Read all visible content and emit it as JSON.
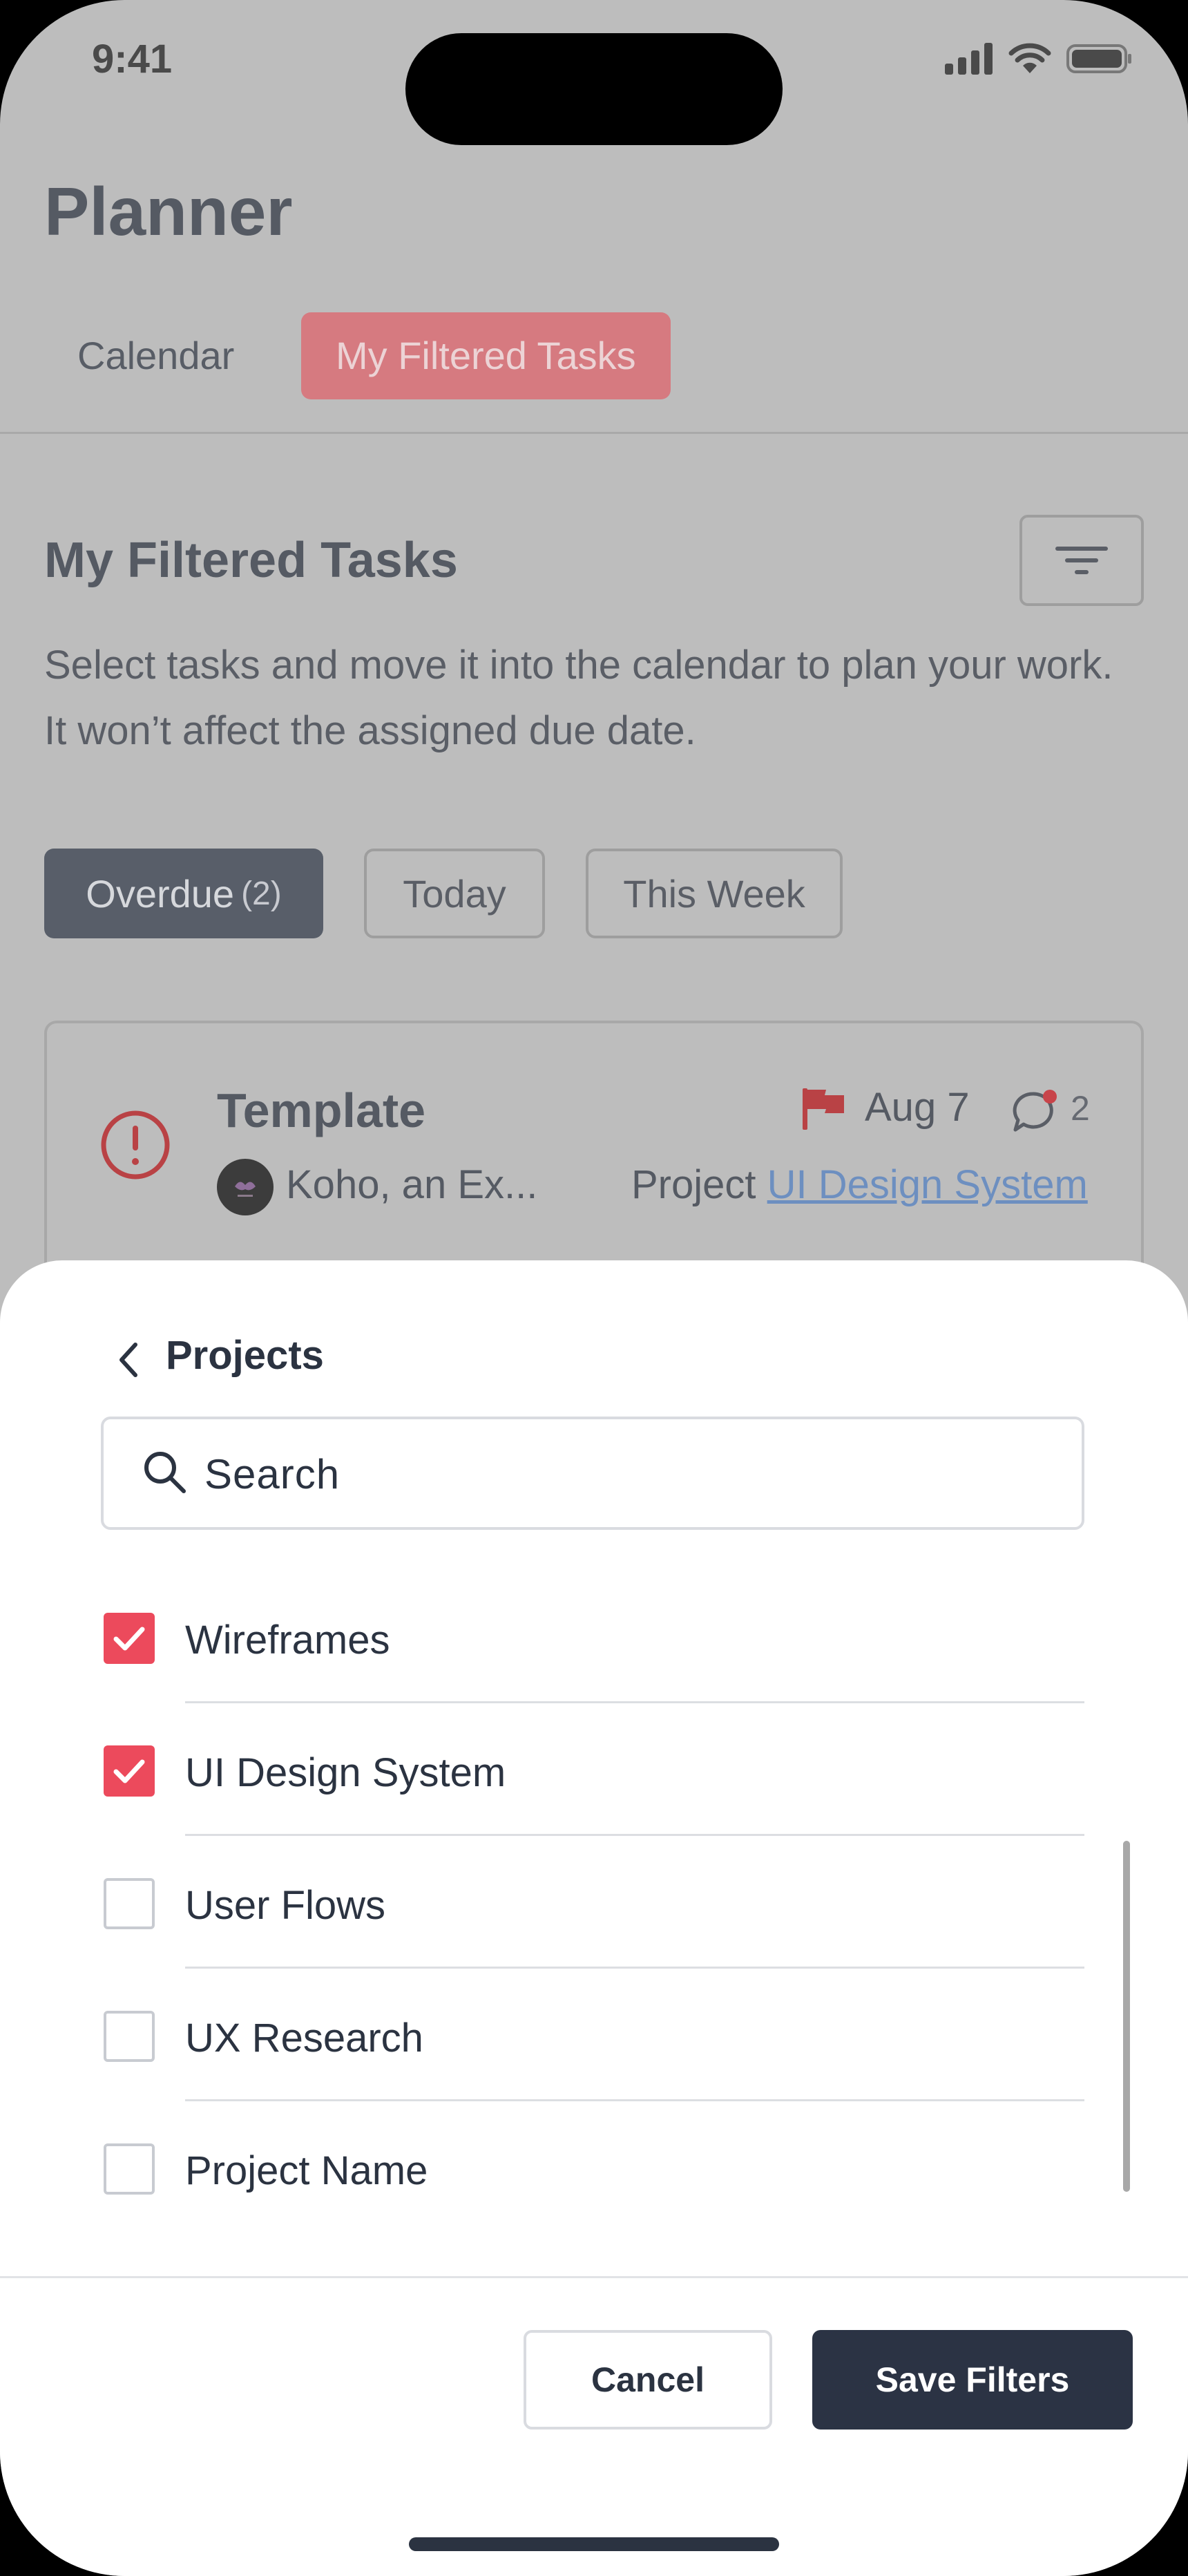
{
  "status_bar": {
    "time": "9:41",
    "icons": [
      "signal-icon",
      "wifi-icon",
      "battery-icon"
    ]
  },
  "header": {
    "title": "Planner",
    "tabs": [
      {
        "label": "Calendar",
        "active": false
      },
      {
        "label": "My Filtered Tasks",
        "active": true
      }
    ]
  },
  "section": {
    "title": "My Filtered Tasks",
    "filter_icon": "filter-icon",
    "description": "Select tasks and move it into the calendar to plan your work. It won’t affect the assigned due date."
  },
  "chips": {
    "overdue": {
      "label": "Overdue",
      "count": "(2)"
    },
    "today": {
      "label": "Today"
    },
    "this_week": {
      "label": "This Week"
    }
  },
  "task": {
    "title": "Template",
    "assignee": "Koho, an Ex...",
    "due_date": "Aug 7",
    "comment_count": "2",
    "project_prefix": "Project",
    "project_name": "UI Design System",
    "icons": [
      "alert-icon",
      "flag-icon",
      "comment-icon"
    ]
  },
  "sheet": {
    "title": "Projects",
    "search_placeholder": "Search",
    "items": [
      {
        "label": "Wireframes",
        "checked": true
      },
      {
        "label": "UI Design System",
        "checked": true
      },
      {
        "label": "User Flows",
        "checked": false
      },
      {
        "label": "UX Research",
        "checked": false
      },
      {
        "label": "Project Name",
        "checked": false
      }
    ],
    "cancel_label": "Cancel",
    "save_label": "Save Filters"
  },
  "colors": {
    "accent": "#ec4a5c",
    "primary_button": "#2b3344",
    "overlay": "#bdbdbd",
    "link": "#6d8fc0"
  }
}
